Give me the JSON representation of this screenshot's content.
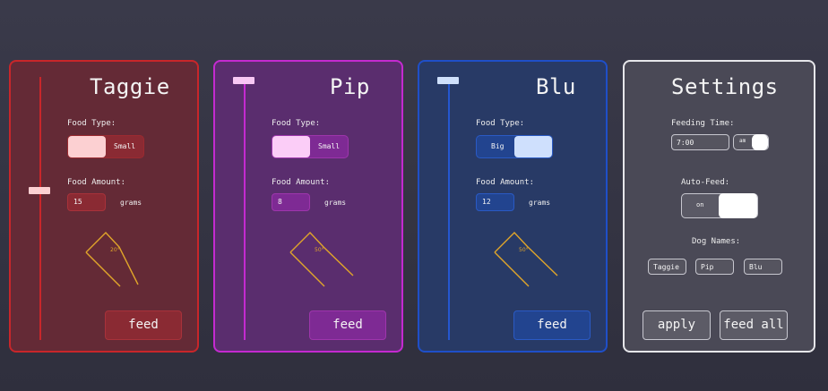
{
  "dogs": [
    {
      "name": "Taggie",
      "food_type_label": "Food Type:",
      "food_type_option": "Small",
      "food_amount_label": "Food Amount:",
      "amount": "15",
      "unit": "grams",
      "angle": "20°",
      "button": "feed",
      "slider_level": 0.5
    },
    {
      "name": "Pip",
      "food_type_label": "Food Type:",
      "food_type_option": "Small",
      "food_amount_label": "Food Amount:",
      "amount": "8",
      "unit": "grams",
      "angle": "50°",
      "button": "feed",
      "slider_level": 1.0
    },
    {
      "name": "Blu",
      "food_type_label": "Food Type:",
      "food_type_option": "Big",
      "food_amount_label": "Food Amount:",
      "amount": "12",
      "unit": "grams",
      "angle": "50°",
      "button": "feed",
      "slider_level": 1.0
    }
  ],
  "settings": {
    "title": "Settings",
    "feeding_time_label": "Feeding Time:",
    "feeding_time_value": "7:00",
    "am_pm": "am",
    "auto_feed_label": "Auto-Feed:",
    "auto_feed_state": "on",
    "dog_names_label": "Dog Names:",
    "dog_names": [
      "Taggie",
      "Pip",
      "Blu"
    ],
    "apply_button": "apply",
    "feed_all_button": "feed all"
  },
  "colors": {
    "taggie_accent": "#c8262a",
    "pip_accent": "#c42ad0",
    "blu_accent": "#1f4fc8",
    "settings_border": "#e6e6ea",
    "gauge": "#e0a52a"
  }
}
